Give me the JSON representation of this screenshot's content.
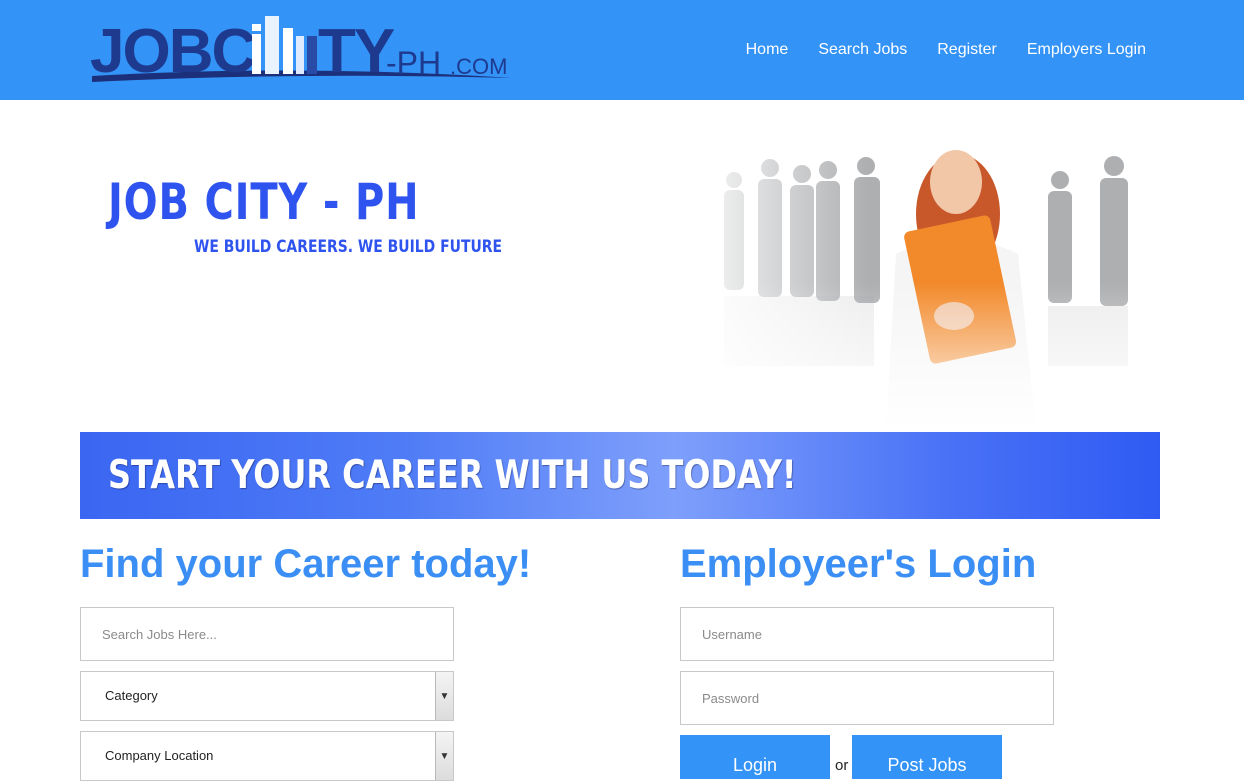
{
  "header": {
    "logo": {
      "text": "JOBCITY-PH.COM"
    },
    "nav": [
      "Home",
      "Search Jobs",
      "Register",
      "Employers Login"
    ]
  },
  "hero": {
    "title": "JOB CITY - PH",
    "tagline": "WE BUILD CAREERS. WE BUILD FUTURE",
    "photo_label": "group of business professionals"
  },
  "banner": {
    "text": "START YOUR CAREER WITH US TODAY!"
  },
  "job_search": {
    "title": "Find your Career today!",
    "search_placeholder": "Search Jobs Here...",
    "category_value": "Category",
    "location_value": "Company Location"
  },
  "employer_login": {
    "title": "Employeer's Login",
    "username_placeholder": "Username",
    "password_placeholder": "Password",
    "login_label": "Login",
    "or_text": "or",
    "post_jobs_label": "Post Jobs"
  },
  "colors": {
    "header_bg": "#3393f7",
    "heading_blue": "#3a8ef4",
    "hero_blue": "#2f53ef",
    "button_bg": "#3393f7"
  }
}
